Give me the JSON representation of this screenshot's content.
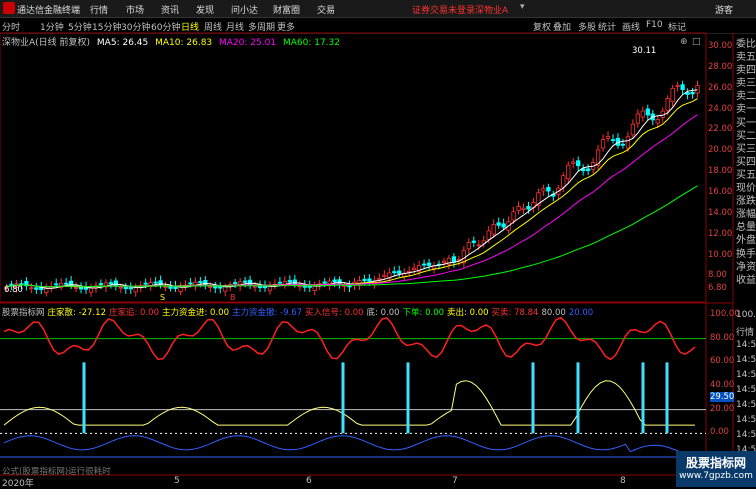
{
  "app": {
    "name": "通达信金融终端",
    "menus": [
      "行情",
      "市场",
      "资讯",
      "发现",
      "问小达",
      "财富圈",
      "交易"
    ],
    "login_warning": "证券交易未登录",
    "stock_name": "深物业A",
    "guest": "游客"
  },
  "periods": {
    "items": [
      "分时",
      "1分钟",
      "5分钟",
      "15分钟",
      "30分钟",
      "60分钟",
      "日线",
      "周线",
      "月线",
      "多周期",
      "更多"
    ],
    "active": "日线"
  },
  "right_tools": [
    "复权",
    "叠加",
    "多股",
    "统计",
    "画线",
    "F10",
    "标记"
  ],
  "main_legend": {
    "title": "深物业A(日线 前复权)",
    "ma5_label": "MA5: 26.45",
    "ma10_label": "MA10: 26.83",
    "ma20_label": "MA20: 25.01",
    "ma60_label": "MA60: 17.32",
    "colors": {
      "ma5": "#ffffff",
      "ma10": "#ffff00",
      "ma20": "#ff00ff",
      "ma60": "#00ff00"
    }
  },
  "price_axis": [
    "30.00",
    "28.00",
    "26.00",
    "24.00",
    "22.00",
    "20.00",
    "18.00",
    "16.00",
    "14.00",
    "12.00",
    "10.00",
    "8.00",
    "6.80"
  ],
  "annotations": {
    "high": "30.11",
    "low": "6.80"
  },
  "side_panel": [
    "委比",
    "卖五",
    "卖四",
    "卖三",
    "卖二",
    "卖一",
    "买一",
    "买二",
    "买三",
    "买四",
    "买五",
    "现价",
    "涨跌",
    "涨幅",
    "总量",
    "外盘",
    "换手",
    "净资",
    "收益"
  ],
  "indicator": {
    "legend": [
      {
        "text": "股票指标网",
        "color": "#c0c0c0"
      },
      {
        "text": "庄家散: -27.12",
        "color": "#ffff00"
      },
      {
        "text": "庄家追: 0.00",
        "color": "#ff3030"
      },
      {
        "text": "主力资金进: 0.00",
        "color": "#ffff00"
      },
      {
        "text": "主力资金撤: -9.67",
        "color": "#3060ff"
      },
      {
        "text": "买入信号: 0.00",
        "color": "#ff3030"
      },
      {
        "text": "底: 0.00",
        "color": "#c0c0c0"
      },
      {
        "text": "下单: 0.00",
        "color": "#00ff00"
      },
      {
        "text": "卖出: 0.00",
        "color": "#ffff00"
      },
      {
        "text": "买卖: 78.84",
        "color": "#ff3030"
      },
      {
        "text": "80.00",
        "color": "#c0c0c0"
      },
      {
        "text": "20.00",
        "color": "#3060ff"
      }
    ],
    "axis": [
      "100.00",
      "80.00",
      "60.00",
      "40.00",
      "29.50",
      "20.00",
      "0.00",
      "-20.00"
    ],
    "formula_note": "公式(股票指标网)运行很耗时"
  },
  "right_lower": [
    "100.0",
    "行情",
    "14:50",
    "14:50",
    "14:50",
    "14:50",
    "14:50",
    "14:50",
    "14:50",
    "14:50",
    "14:50"
  ],
  "x_axis": [
    "2020年",
    "5",
    "6",
    "7",
    "8"
  ],
  "marks": {
    "buy1": "S",
    "buy2": "B"
  },
  "watermark": {
    "line1": "股票指标网",
    "line2": "www.7gpzb.com"
  }
}
